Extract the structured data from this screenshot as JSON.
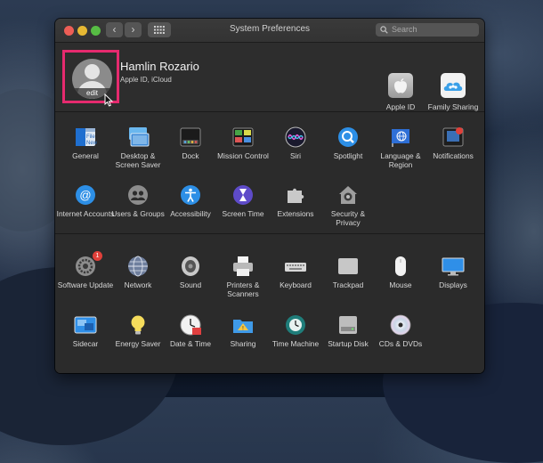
{
  "window": {
    "title": "System Preferences"
  },
  "toolbar": {
    "back_icon": "chevron-left-icon",
    "forward_icon": "chevron-right-icon",
    "grid_icon": "grid-icon",
    "search_placeholder": "Search"
  },
  "account": {
    "name": "Hamlin Rozario",
    "subtitle": "Apple ID, iCloud",
    "avatar_edit_label": "edit",
    "items": [
      {
        "label": "Apple ID",
        "icon": "apple-icon"
      },
      {
        "label": "Family Sharing",
        "icon": "family-sharing-icon"
      }
    ]
  },
  "section1": [
    {
      "label": "General",
      "icon": "general-icon"
    },
    {
      "label": "Desktop & Screen Saver",
      "icon": "desktop-icon"
    },
    {
      "label": "Dock",
      "icon": "dock-icon"
    },
    {
      "label": "Mission Control",
      "icon": "mission-control-icon"
    },
    {
      "label": "Siri",
      "icon": "siri-icon"
    },
    {
      "label": "Spotlight",
      "icon": "spotlight-icon"
    },
    {
      "label": "Language & Region",
      "icon": "flag-globe-icon"
    },
    {
      "label": "Notifications",
      "icon": "notifications-icon"
    },
    {
      "label": "Internet Accounts",
      "icon": "at-icon"
    },
    {
      "label": "Users & Groups",
      "icon": "users-icon"
    },
    {
      "label": "Accessibility",
      "icon": "accessibility-icon"
    },
    {
      "label": "Screen Time",
      "icon": "hourglass-icon"
    },
    {
      "label": "Extensions",
      "icon": "puzzle-icon"
    },
    {
      "label": "Security & Privacy",
      "icon": "house-lock-icon"
    }
  ],
  "section2": [
    {
      "label": "Software Update",
      "icon": "gear-icon",
      "badge": "1"
    },
    {
      "label": "Network",
      "icon": "globe-icon"
    },
    {
      "label": "Sound",
      "icon": "speaker-icon"
    },
    {
      "label": "Printers & Scanners",
      "icon": "printer-icon"
    },
    {
      "label": "Keyboard",
      "icon": "keyboard-icon"
    },
    {
      "label": "Trackpad",
      "icon": "trackpad-icon"
    },
    {
      "label": "Mouse",
      "icon": "mouse-icon"
    },
    {
      "label": "Displays",
      "icon": "display-icon"
    },
    {
      "label": "Sidecar",
      "icon": "sidecar-icon"
    },
    {
      "label": "Energy Saver",
      "icon": "bulb-icon"
    },
    {
      "label": "Date & Time",
      "icon": "clock-icon"
    },
    {
      "label": "Sharing",
      "icon": "sharing-folder-icon"
    },
    {
      "label": "Time Machine",
      "icon": "time-machine-icon"
    },
    {
      "label": "Startup Disk",
      "icon": "disk-icon"
    },
    {
      "label": "CDs & DVDs",
      "icon": "cd-icon"
    }
  ],
  "colors": {
    "highlight": "#e62a6e",
    "window_bg": "#2b2b2b",
    "badge": "#e0403a"
  }
}
